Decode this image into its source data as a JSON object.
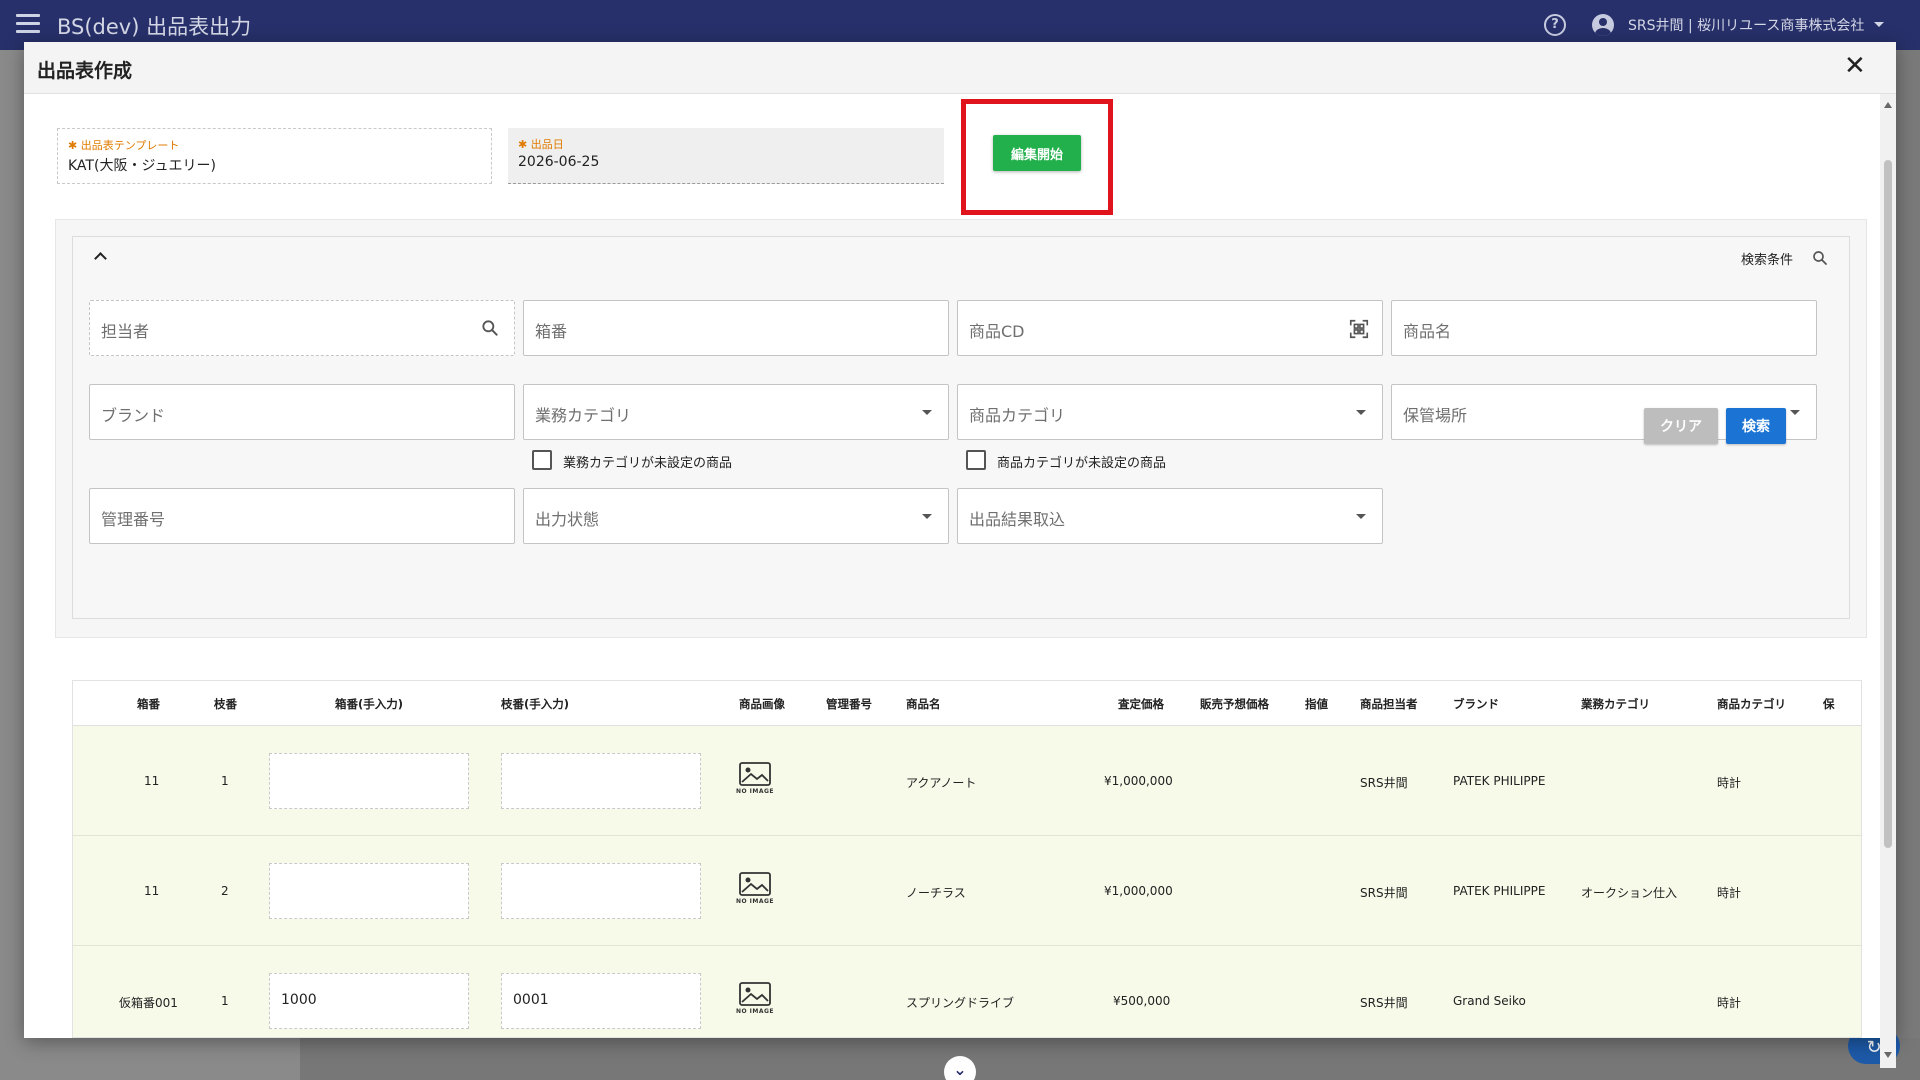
{
  "topbar": {
    "title": "BS(dev) 出品表出力",
    "user": "SRS井間 | 桜川リユース商事株式会社"
  },
  "dialog": {
    "title": "出品表作成",
    "template_field": {
      "label": "出品表テンプレート",
      "value": "KAT(大阪・ジュエリー)"
    },
    "date_field": {
      "label": "出品日",
      "value": "2026-06-25"
    },
    "edit_button": "編集開始"
  },
  "search": {
    "title": "検索条件",
    "fields": {
      "staff": "担当者",
      "box_no": "箱番",
      "product_cd": "商品CD",
      "product_name": "商品名",
      "brand": "ブランド",
      "business_category": "業務カテゴリ",
      "product_category": "商品カテゴリ",
      "storage_location": "保管場所",
      "management_no": "管理番号",
      "output_status": "出力状態",
      "listing_result_import": "出品結果取込"
    },
    "checkboxes": {
      "business_category_unset": "業務カテゴリが未設定の商品",
      "product_category_unset": "商品カテゴリが未設定の商品"
    },
    "clear_button": "クリア",
    "search_button": "検索"
  },
  "table": {
    "headers": [
      "箱番",
      "枝番",
      "箱番(手入力)",
      "枝番(手入力)",
      "商品画像",
      "管理番号",
      "商品名",
      "査定価格",
      "販売予想価格",
      "指値",
      "商品担当者",
      "ブランド",
      "業務カテゴリ",
      "商品カテゴリ",
      "保"
    ],
    "no_image_caption": "NO IMAGE",
    "rows": [
      {
        "box": "11",
        "branch": "1",
        "box_manual": "",
        "branch_manual": "",
        "name": "アクアノート",
        "price": "¥1,000,000",
        "staff": "SRS井間",
        "brand": "PATEK PHILIPPE",
        "business_category": "",
        "product_category": "時計"
      },
      {
        "box": "11",
        "branch": "2",
        "box_manual": "",
        "branch_manual": "",
        "name": "ノーチラス",
        "price": "¥1,000,000",
        "staff": "SRS井間",
        "brand": "PATEK PHILIPPE",
        "business_category": "オークション仕入",
        "product_category": "時計"
      },
      {
        "box": "仮箱番001",
        "branch": "1",
        "box_manual": "1000",
        "branch_manual": "0001",
        "name": "スプリングドライブ",
        "price": "¥500,000",
        "staff": "SRS井間",
        "brand": "Grand Seiko",
        "business_category": "",
        "product_category": "時計"
      }
    ]
  },
  "colors": {
    "topbar": "#27306a",
    "edit_button": "#21b04b",
    "search_button": "#1b74d3",
    "highlight": "#e0141c",
    "row_bg": "#f7f9e9"
  }
}
